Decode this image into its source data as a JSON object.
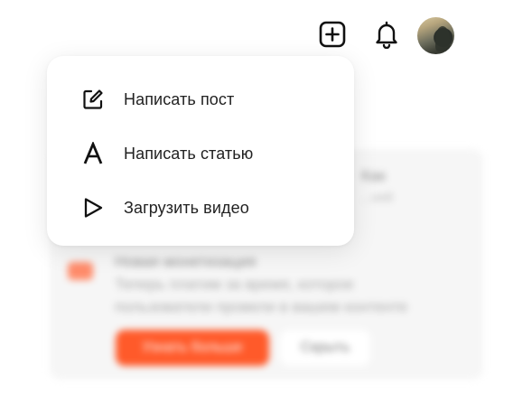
{
  "topbar": {
    "create_icon": "plus-square-icon",
    "notifications_icon": "bell-icon",
    "avatar_icon": "user-avatar"
  },
  "menu": {
    "items": [
      {
        "label": "Написать пост",
        "icon": "edit-icon"
      },
      {
        "label": "Написать статью",
        "icon": "letter-a-icon"
      },
      {
        "label": "Загрузить видео",
        "icon": "play-icon"
      }
    ]
  },
  "background_card": {
    "title_fragment": "Как",
    "subtitle_fragment": "...ней",
    "monetization_title": "Новая монетизация",
    "monetization_line1": "Теперь платим за время, которое",
    "monetization_line2": "пользователи провели в вашем контенте",
    "learn_more_label": "Узнать больше",
    "hide_label": "Скрыть"
  },
  "colors": {
    "accent": "#ff5a2a",
    "text": "#222222",
    "menu_bg": "#ffffff"
  }
}
